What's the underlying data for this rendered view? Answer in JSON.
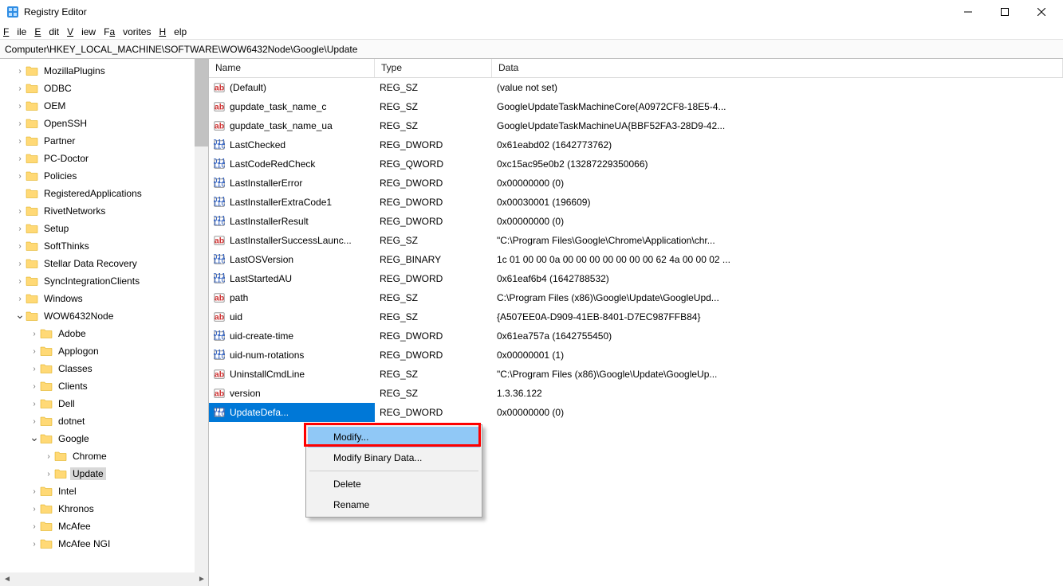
{
  "window": {
    "title": "Registry Editor"
  },
  "menu": {
    "file": "File",
    "edit": "Edit",
    "view": "View",
    "favorites": "Favorites",
    "help": "Help"
  },
  "address": "Computer\\HKEY_LOCAL_MACHINE\\SOFTWARE\\WOW6432Node\\Google\\Update",
  "tree": [
    {
      "indent": 1,
      "exp": ">",
      "label": "MozillaPlugins"
    },
    {
      "indent": 1,
      "exp": ">",
      "label": "ODBC"
    },
    {
      "indent": 1,
      "exp": ">",
      "label": "OEM"
    },
    {
      "indent": 1,
      "exp": ">",
      "label": "OpenSSH"
    },
    {
      "indent": 1,
      "exp": ">",
      "label": "Partner"
    },
    {
      "indent": 1,
      "exp": ">",
      "label": "PC-Doctor"
    },
    {
      "indent": 1,
      "exp": ">",
      "label": "Policies"
    },
    {
      "indent": 1,
      "exp": "",
      "label": "RegisteredApplications"
    },
    {
      "indent": 1,
      "exp": ">",
      "label": "RivetNetworks"
    },
    {
      "indent": 1,
      "exp": ">",
      "label": "Setup"
    },
    {
      "indent": 1,
      "exp": ">",
      "label": "SoftThinks"
    },
    {
      "indent": 1,
      "exp": ">",
      "label": "Stellar Data Recovery"
    },
    {
      "indent": 1,
      "exp": ">",
      "label": "SyncIntegrationClients"
    },
    {
      "indent": 1,
      "exp": ">",
      "label": "Windows"
    },
    {
      "indent": 1,
      "exp": "v",
      "label": "WOW6432Node"
    },
    {
      "indent": 2,
      "exp": ">",
      "label": "Adobe"
    },
    {
      "indent": 2,
      "exp": ">",
      "label": "Applogon"
    },
    {
      "indent": 2,
      "exp": ">",
      "label": "Classes"
    },
    {
      "indent": 2,
      "exp": ">",
      "label": "Clients"
    },
    {
      "indent": 2,
      "exp": ">",
      "label": "Dell"
    },
    {
      "indent": 2,
      "exp": ">",
      "label": "dotnet"
    },
    {
      "indent": 2,
      "exp": "v",
      "label": "Google"
    },
    {
      "indent": 3,
      "exp": ">",
      "label": "Chrome"
    },
    {
      "indent": 3,
      "exp": ">",
      "label": "Update",
      "selected": true
    },
    {
      "indent": 2,
      "exp": ">",
      "label": "Intel"
    },
    {
      "indent": 2,
      "exp": ">",
      "label": "Khronos"
    },
    {
      "indent": 2,
      "exp": ">",
      "label": "McAfee"
    },
    {
      "indent": 2,
      "exp": ">",
      "label": "McAfee NGI"
    }
  ],
  "columns": {
    "name": "Name",
    "type": "Type",
    "data": "Data"
  },
  "rows": [
    {
      "icon": "sz",
      "name": "(Default)",
      "type": "REG_SZ",
      "data": "(value not set)"
    },
    {
      "icon": "sz",
      "name": "gupdate_task_name_c",
      "type": "REG_SZ",
      "data": "GoogleUpdateTaskMachineCore{A0972CF8-18E5-4..."
    },
    {
      "icon": "sz",
      "name": "gupdate_task_name_ua",
      "type": "REG_SZ",
      "data": "GoogleUpdateTaskMachineUA{BBF52FA3-28D9-42..."
    },
    {
      "icon": "bin",
      "name": "LastChecked",
      "type": "REG_DWORD",
      "data": "0x61eabd02 (1642773762)"
    },
    {
      "icon": "bin",
      "name": "LastCodeRedCheck",
      "type": "REG_QWORD",
      "data": "0xc15ac95e0b2 (13287229350066)"
    },
    {
      "icon": "bin",
      "name": "LastInstallerError",
      "type": "REG_DWORD",
      "data": "0x00000000 (0)"
    },
    {
      "icon": "bin",
      "name": "LastInstallerExtraCode1",
      "type": "REG_DWORD",
      "data": "0x00030001 (196609)"
    },
    {
      "icon": "bin",
      "name": "LastInstallerResult",
      "type": "REG_DWORD",
      "data": "0x00000000 (0)"
    },
    {
      "icon": "sz",
      "name": "LastInstallerSuccessLaunc...",
      "type": "REG_SZ",
      "data": "\"C:\\Program Files\\Google\\Chrome\\Application\\chr..."
    },
    {
      "icon": "bin",
      "name": "LastOSVersion",
      "type": "REG_BINARY",
      "data": "1c 01 00 00 0a 00 00 00 00 00 00 00 62 4a 00 00 02 ..."
    },
    {
      "icon": "bin",
      "name": "LastStartedAU",
      "type": "REG_DWORD",
      "data": "0x61eaf6b4 (1642788532)"
    },
    {
      "icon": "sz",
      "name": "path",
      "type": "REG_SZ",
      "data": "C:\\Program Files (x86)\\Google\\Update\\GoogleUpd..."
    },
    {
      "icon": "sz",
      "name": "uid",
      "type": "REG_SZ",
      "data": "{A507EE0A-D909-41EB-8401-D7EC987FFB84}"
    },
    {
      "icon": "bin",
      "name": "uid-create-time",
      "type": "REG_DWORD",
      "data": "0x61ea757a (1642755450)"
    },
    {
      "icon": "bin",
      "name": "uid-num-rotations",
      "type": "REG_DWORD",
      "data": "0x00000001 (1)"
    },
    {
      "icon": "sz",
      "name": "UninstallCmdLine",
      "type": "REG_SZ",
      "data": "\"C:\\Program Files (x86)\\Google\\Update\\GoogleUp..."
    },
    {
      "icon": "sz",
      "name": "version",
      "type": "REG_SZ",
      "data": "1.3.36.122"
    },
    {
      "icon": "bin",
      "name": "UpdateDefa...",
      "type": "REG_DWORD",
      "data": "0x00000000 (0)",
      "selected": true
    }
  ],
  "context_menu": {
    "modify": "Modify...",
    "modify_binary": "Modify Binary Data...",
    "delete": "Delete",
    "rename": "Rename"
  }
}
